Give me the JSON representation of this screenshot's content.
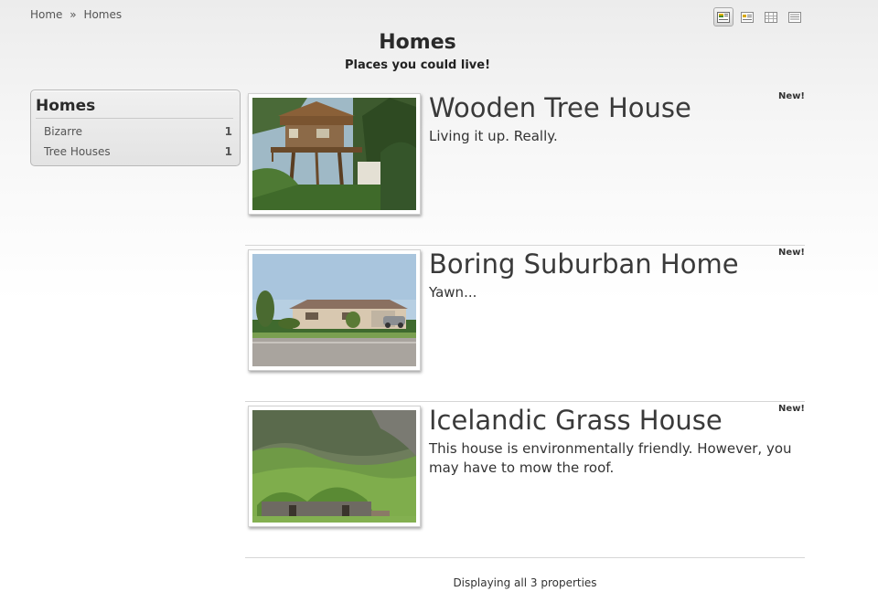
{
  "breadcrumb": {
    "items": [
      "Home",
      "Homes"
    ],
    "separator": "»"
  },
  "view_switcher": {
    "buttons": [
      {
        "icon": "image-list-view-icon",
        "active": true
      },
      {
        "icon": "detail-view-icon",
        "active": false
      },
      {
        "icon": "grid-view-icon",
        "active": false
      },
      {
        "icon": "text-list-view-icon",
        "active": false
      }
    ]
  },
  "header": {
    "title": "Homes",
    "subtitle": "Places you could live!"
  },
  "sidebar": {
    "title": "Homes",
    "items": [
      {
        "label": "Bizarre",
        "count": "1"
      },
      {
        "label": "Tree Houses",
        "count": "1"
      }
    ]
  },
  "properties": [
    {
      "name": "Wooden Tree House",
      "description": "Living it up. Really.",
      "badge": "New!",
      "photo": "tree-house-photo"
    },
    {
      "name": "Boring Suburban Home",
      "description": "Yawn...",
      "badge": "New!",
      "photo": "suburban-home-photo"
    },
    {
      "name": "Icelandic Grass House",
      "description": "This house is environmentally friendly. However, you may have to mow the roof.",
      "badge": "New!",
      "photo": "grass-house-photo"
    }
  ],
  "footer": {
    "summary": "Displaying all 3 properties"
  },
  "colors": {
    "text": "#333333",
    "border": "#d6d6d6",
    "sidebar_bg": "#e8e8e8"
  }
}
